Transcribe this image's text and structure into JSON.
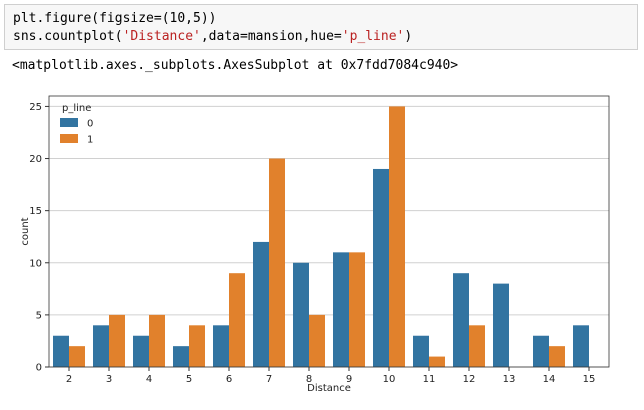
{
  "code_cell": {
    "line1": "plt.figure(figsize=(10,5))",
    "line2_prefix": "sns.countplot(",
    "line2_str1": "'Distance'",
    "line2_mid": ",data=mansion,hue=",
    "line2_str2": "'p_line'",
    "line2_suffix": ")"
  },
  "output_text": "<matplotlib.axes._subplots.AxesSubplot at 0x7fdd7084c940>",
  "colors": {
    "series0": "#3274a1",
    "series1": "#e1812c",
    "grid": "#d0d0d0",
    "axes_edge": "#333333"
  },
  "chart_data": {
    "type": "bar",
    "title": "",
    "xlabel": "Distance",
    "ylabel": "count",
    "ylim": [
      0,
      26
    ],
    "yticks": [
      0,
      5,
      10,
      15,
      20,
      25
    ],
    "grid": "horizontal",
    "legend_position": "top-left",
    "legend_title": "p_line",
    "categories": [
      "2",
      "3",
      "4",
      "5",
      "6",
      "7",
      "8",
      "9",
      "10",
      "11",
      "12",
      "13",
      "14",
      "15"
    ],
    "series": [
      {
        "name": "0",
        "values": [
          3,
          4,
          3,
          2,
          4,
          12,
          10,
          11,
          19,
          3,
          9,
          8,
          3,
          4
        ]
      },
      {
        "name": "1",
        "values": [
          2,
          5,
          5,
          4,
          9,
          20,
          5,
          11,
          25,
          1,
          4,
          0,
          2,
          0
        ]
      }
    ]
  }
}
